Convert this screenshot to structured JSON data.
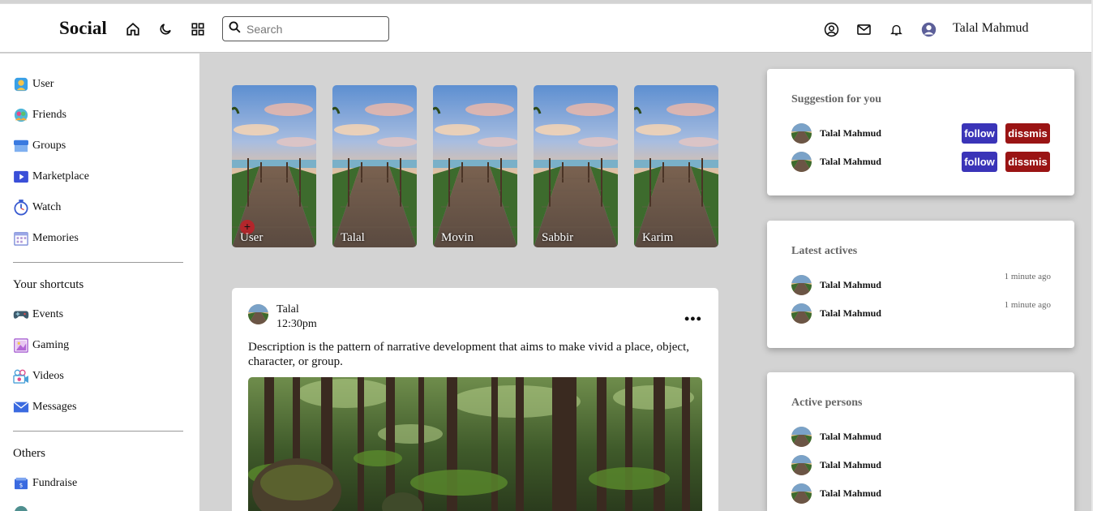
{
  "header": {
    "logo": "Social",
    "search_placeholder": "Search",
    "user_name": "Talal Mahmud"
  },
  "sidebar": {
    "items": [
      {
        "label": "User",
        "icon": "user-icon"
      },
      {
        "label": "Friends",
        "icon": "friends-icon"
      },
      {
        "label": "Groups",
        "icon": "groups-icon"
      },
      {
        "label": "Marketplace",
        "icon": "marketplace-icon"
      },
      {
        "label": "Watch",
        "icon": "watch-icon"
      },
      {
        "label": "Memories",
        "icon": "memories-icon"
      }
    ],
    "shortcuts_title": "Your shortcuts",
    "shortcuts": [
      {
        "label": "Events",
        "icon": "gamepad-icon"
      },
      {
        "label": "Gaming",
        "icon": "gaming-icon"
      },
      {
        "label": "Videos",
        "icon": "videos-icon"
      },
      {
        "label": "Messages",
        "icon": "messages-icon"
      }
    ],
    "others_title": "Others",
    "others": [
      {
        "label": "Fundraise",
        "icon": "fundraise-icon"
      }
    ]
  },
  "stories": [
    {
      "name": "User",
      "is_own": true
    },
    {
      "name": "Talal"
    },
    {
      "name": "Movin"
    },
    {
      "name": "Sabbir"
    },
    {
      "name": "Karim"
    }
  ],
  "post": {
    "author": "Talal",
    "time": "12:30pm",
    "more": "•••",
    "description": "Description is the pattern of narrative development that aims to make vivid a place, object, character, or group."
  },
  "suggestions": {
    "title": "Suggestion for you",
    "follow_label": "follow",
    "dismiss_label": "dissmis",
    "people": [
      {
        "name": "Talal Mahmud"
      },
      {
        "name": "Talal Mahmud"
      }
    ]
  },
  "latest": {
    "title": "Latest actives",
    "items": [
      {
        "name": "Talal Mahmud",
        "time": "1 minute ago"
      },
      {
        "name": "Talal Mahmud",
        "time": "1 minute ago"
      }
    ]
  },
  "active": {
    "title": "Active persons",
    "people": [
      {
        "name": "Talal Mahmud"
      },
      {
        "name": "Talal Mahmud"
      },
      {
        "name": "Talal Mahmud"
      }
    ]
  },
  "colors": {
    "follow": "#3a34b8",
    "dismiss": "#9a1414",
    "background": "#d3d3d3"
  }
}
